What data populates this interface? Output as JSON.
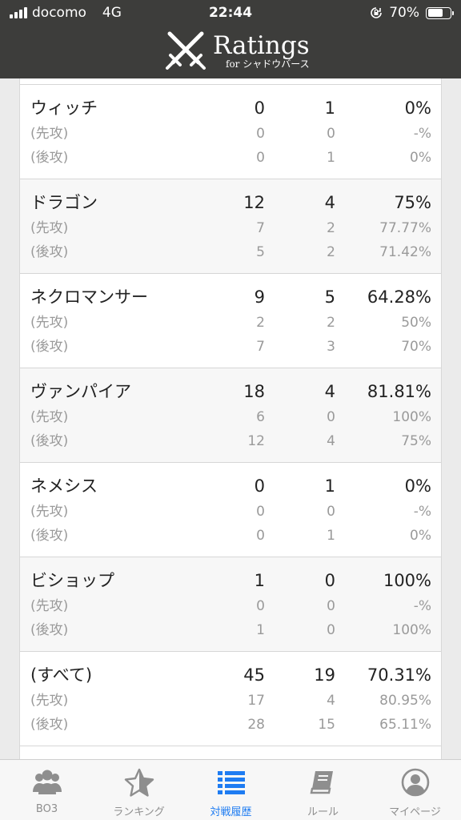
{
  "status": {
    "carrier": "docomo",
    "network": "4G",
    "time": "22:44",
    "battery": "70%",
    "battery_level": 0.7
  },
  "header": {
    "title": "Ratings",
    "subtitle": "for シャドウバース"
  },
  "groups": [
    {
      "name": "ウィッチ",
      "win": "0",
      "loss": "1",
      "rate": "0%",
      "first": {
        "label": "(先攻)",
        "win": "0",
        "loss": "0",
        "rate": "-%"
      },
      "second": {
        "label": "(後攻)",
        "win": "0",
        "loss": "1",
        "rate": "0%"
      }
    },
    {
      "name": "ドラゴン",
      "win": "12",
      "loss": "4",
      "rate": "75%",
      "first": {
        "label": "(先攻)",
        "win": "7",
        "loss": "2",
        "rate": "77.77%"
      },
      "second": {
        "label": "(後攻)",
        "win": "5",
        "loss": "2",
        "rate": "71.42%"
      }
    },
    {
      "name": "ネクロマンサー",
      "win": "9",
      "loss": "5",
      "rate": "64.28%",
      "first": {
        "label": "(先攻)",
        "win": "2",
        "loss": "2",
        "rate": "50%"
      },
      "second": {
        "label": "(後攻)",
        "win": "7",
        "loss": "3",
        "rate": "70%"
      }
    },
    {
      "name": "ヴァンパイア",
      "win": "18",
      "loss": "4",
      "rate": "81.81%",
      "first": {
        "label": "(先攻)",
        "win": "6",
        "loss": "0",
        "rate": "100%"
      },
      "second": {
        "label": "(後攻)",
        "win": "12",
        "loss": "4",
        "rate": "75%"
      }
    },
    {
      "name": "ネメシス",
      "win": "0",
      "loss": "1",
      "rate": "0%",
      "first": {
        "label": "(先攻)",
        "win": "0",
        "loss": "0",
        "rate": "-%"
      },
      "second": {
        "label": "(後攻)",
        "win": "0",
        "loss": "1",
        "rate": "0%"
      }
    },
    {
      "name": "ビショップ",
      "win": "1",
      "loss": "0",
      "rate": "100%",
      "first": {
        "label": "(先攻)",
        "win": "0",
        "loss": "0",
        "rate": "-%"
      },
      "second": {
        "label": "(後攻)",
        "win": "1",
        "loss": "0",
        "rate": "100%"
      }
    },
    {
      "name": "(すべて)",
      "win": "45",
      "loss": "19",
      "rate": "70.31%",
      "first": {
        "label": "(先攻)",
        "win": "17",
        "loss": "4",
        "rate": "80.95%"
      },
      "second": {
        "label": "(後攻)",
        "win": "28",
        "loss": "15",
        "rate": "65.11%"
      }
    }
  ],
  "tabs": [
    {
      "label": "BO3",
      "icon": "group-icon"
    },
    {
      "label": "ランキング",
      "icon": "star-icon"
    },
    {
      "label": "対戦履歴",
      "icon": "list-icon"
    },
    {
      "label": "ルール",
      "icon": "book-icon"
    },
    {
      "label": "マイページ",
      "icon": "user-icon"
    }
  ],
  "colors": {
    "header_bg": "#3d3d3b",
    "active_tab": "#1e7cf2",
    "inactive_tab": "#8e8e8e"
  }
}
